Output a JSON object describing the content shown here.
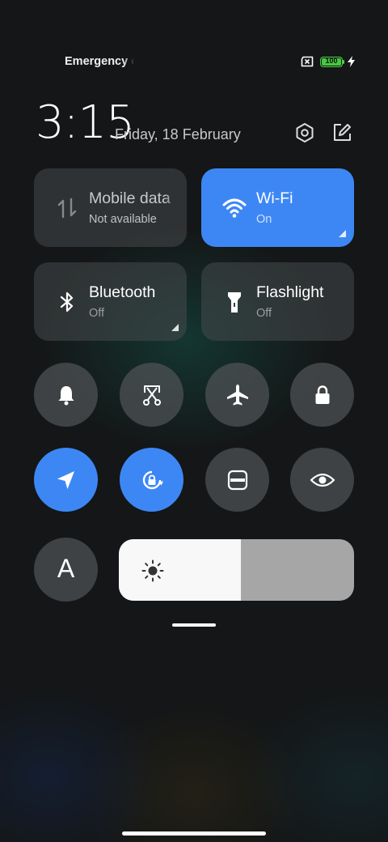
{
  "status_bar": {
    "carrier": "Emergency c",
    "battery_level": "100"
  },
  "header": {
    "time": "3:15",
    "date": "Friday, 18 February"
  },
  "tiles": [
    {
      "title": "Mobile data",
      "subtitle": "Not available",
      "state": "disabled",
      "icon": "mobile-data-icon"
    },
    {
      "title": "Wi-Fi",
      "subtitle": "On",
      "state": "on",
      "icon": "wifi-icon"
    },
    {
      "title": "Bluetooth",
      "subtitle": "Off",
      "state": "off",
      "icon": "bluetooth-icon"
    },
    {
      "title": "Flashlight",
      "subtitle": "Off",
      "state": "off",
      "icon": "flashlight-icon"
    }
  ],
  "toggles": [
    {
      "icon": "bell-icon",
      "state": "off"
    },
    {
      "icon": "screenshot-icon",
      "state": "off"
    },
    {
      "icon": "airplane-icon",
      "state": "off"
    },
    {
      "icon": "lock-icon",
      "state": "off"
    },
    {
      "icon": "location-icon",
      "state": "on"
    },
    {
      "icon": "rotation-lock-icon",
      "state": "on"
    },
    {
      "icon": "reading-mode-icon",
      "state": "off"
    },
    {
      "icon": "eye-icon",
      "state": "off"
    }
  ],
  "auto_brightness_label": "A",
  "brightness": {
    "level_percent": 52
  },
  "colors": {
    "accent": "#3d87f5",
    "tile_bg": "#464a4c",
    "battery": "#46c93e"
  }
}
